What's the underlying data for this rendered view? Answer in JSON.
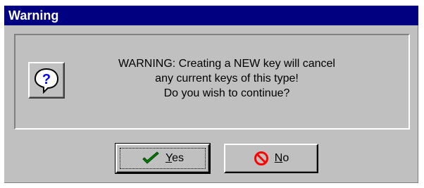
{
  "window": {
    "title": "Warning"
  },
  "message": {
    "line1": "WARNING: Creating a NEW key will cancel",
    "line2": "any current keys of this type!",
    "line3": "Do you wish to continue?"
  },
  "icons": {
    "dialog_icon": "question-icon",
    "yes_icon": "checkmark-icon",
    "no_icon": "prohibited-icon"
  },
  "buttons": {
    "yes": {
      "mnemonic": "Y",
      "rest": "es"
    },
    "no": {
      "mnemonic": "N",
      "rest": "o"
    }
  },
  "colors": {
    "titlebar": "#000080",
    "dialog_bg": "#c0c0c0",
    "question_blue": "#0000ff",
    "check_green": "#008000",
    "no_red": "#ff0000"
  }
}
